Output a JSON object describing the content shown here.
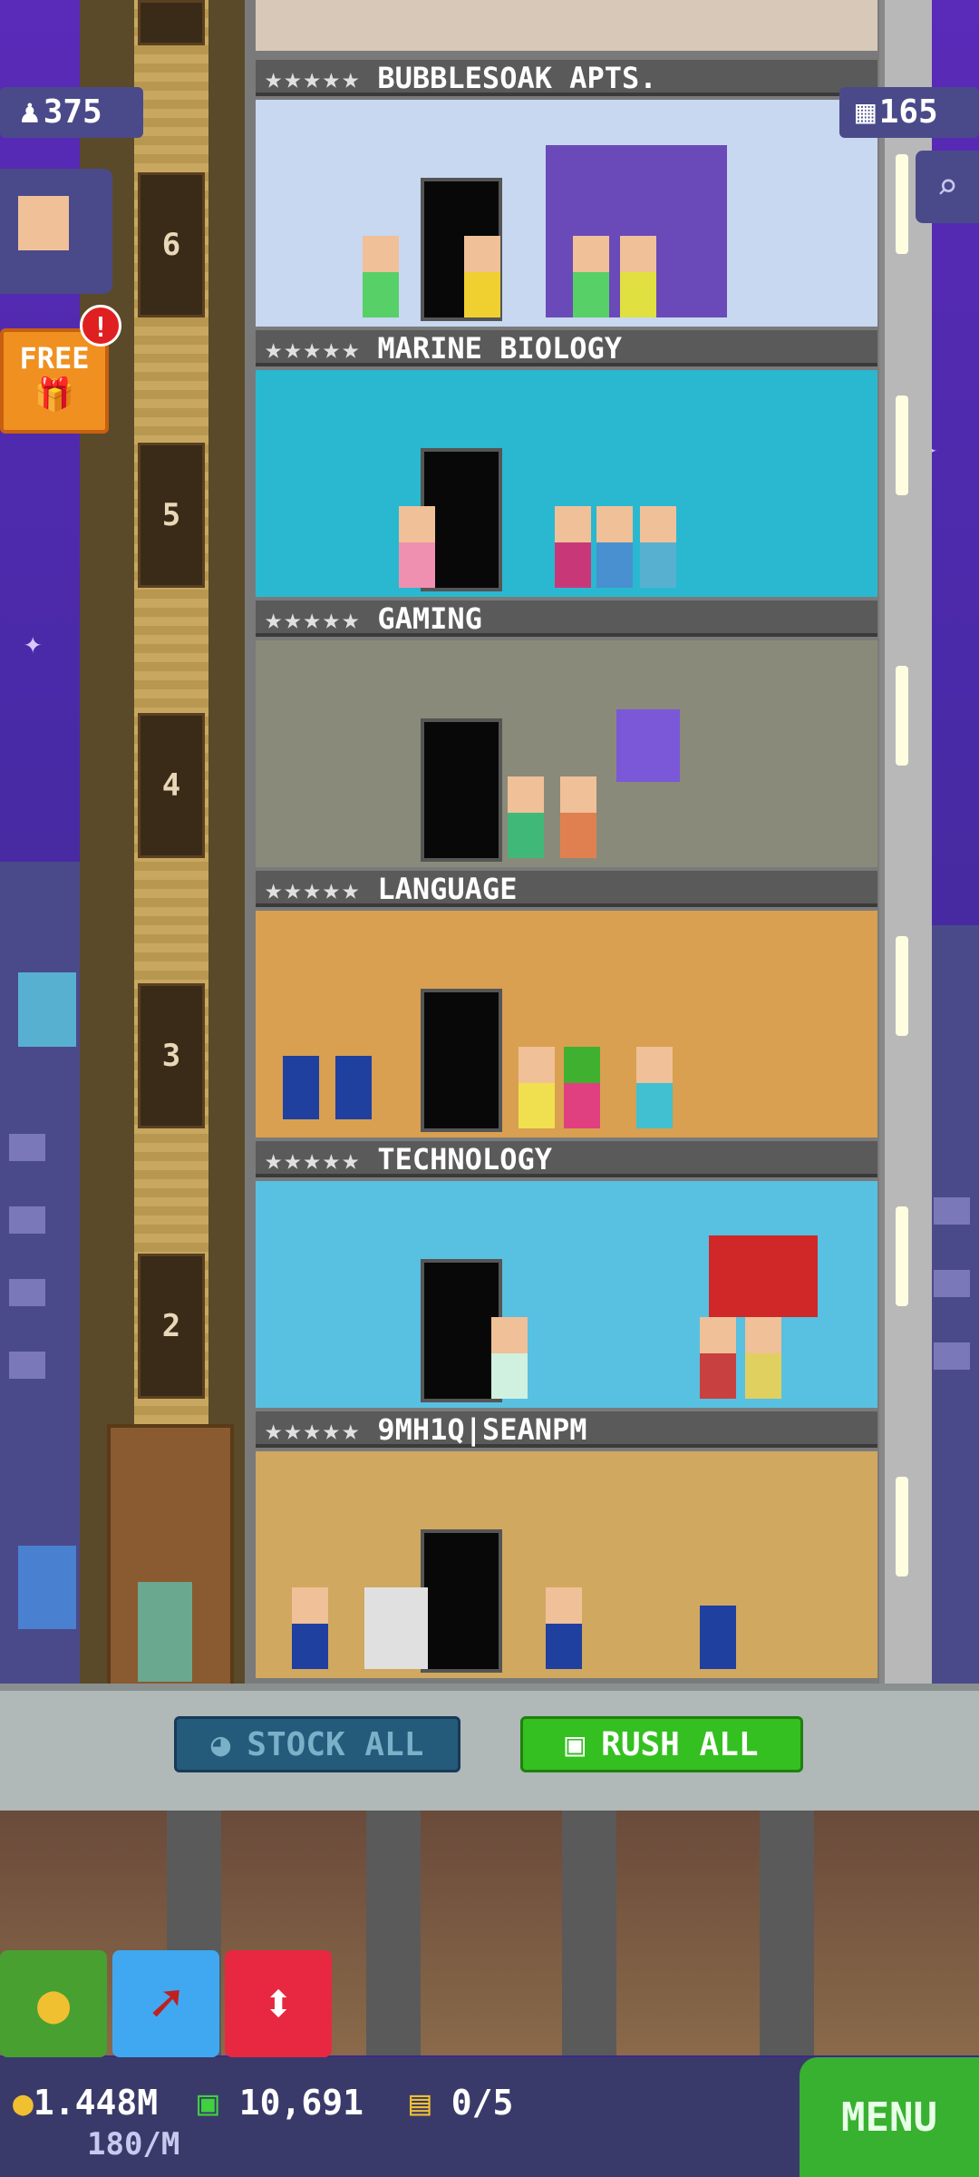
{
  "top_left_counter": {
    "icon": "person-icon",
    "value": "375"
  },
  "top_right_counter": {
    "icon": "bux-building-icon",
    "value": "165"
  },
  "free_button": {
    "label": "FREE",
    "alert": "!"
  },
  "floors": [
    {
      "number": "6",
      "name": "BUBBLESOAK APTS.",
      "stars": "★★★★★",
      "color": "#c8d8f0"
    },
    {
      "number": "5",
      "name": "MARINE BIOLOGY",
      "stars": "★★★★★",
      "color": "#2ab8d0"
    },
    {
      "number": "4",
      "name": "GAMING",
      "stars": "★★★★★",
      "color": "#8a8a7a"
    },
    {
      "number": "3",
      "name": "LANGUAGE",
      "stars": "★★★★★",
      "color": "#d8a050"
    },
    {
      "number": "2",
      "name": "TECHNOLOGY",
      "stars": "★★★★★",
      "color": "#58c0e0"
    },
    {
      "number": "",
      "name": "9MH1Q|SEANPM",
      "stars": "★★★★★",
      "color": "#d0a860"
    }
  ],
  "actions": {
    "stock_all": "STOCK ALL",
    "rush_all": "RUSH ALL"
  },
  "status": {
    "coins": "1.448M",
    "coins_rate": "180/M",
    "bux": "10,691",
    "tickets": "0/5",
    "menu": "MENU"
  }
}
